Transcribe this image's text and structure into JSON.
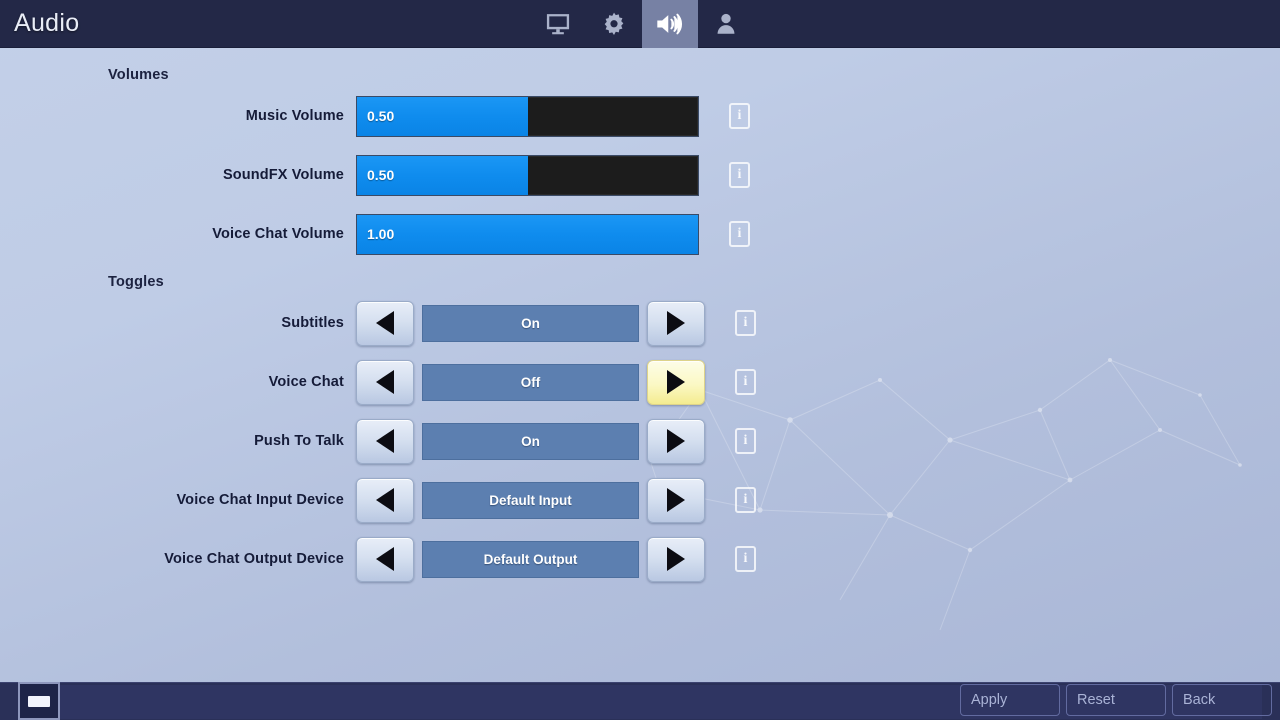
{
  "header": {
    "title": "Audio",
    "tabs": [
      {
        "id": "video",
        "icon": "monitor-icon",
        "active": false
      },
      {
        "id": "game",
        "icon": "gear-icon",
        "active": false
      },
      {
        "id": "audio",
        "icon": "speaker-icon",
        "active": true
      },
      {
        "id": "account",
        "icon": "person-icon",
        "active": false
      }
    ]
  },
  "sections": {
    "volumes_title": "Volumes",
    "toggles_title": "Toggles"
  },
  "volumes": [
    {
      "label": "Music Volume",
      "value": "0.50",
      "fill_percent": 50,
      "info": "i"
    },
    {
      "label": "SoundFX Volume",
      "value": "0.50",
      "fill_percent": 50,
      "info": "i"
    },
    {
      "label": "Voice Chat Volume",
      "value": "1.00",
      "fill_percent": 100,
      "info": "i"
    }
  ],
  "toggles": [
    {
      "label": "Subtitles",
      "value": "On",
      "left_arrow": "◀",
      "right_arrow": "▶",
      "right_highlighted": false,
      "info": "i"
    },
    {
      "label": "Voice Chat",
      "value": "Off",
      "left_arrow": "◀",
      "right_arrow": "▶",
      "right_highlighted": true,
      "info": "i"
    },
    {
      "label": "Push To Talk",
      "value": "On",
      "left_arrow": "◀",
      "right_arrow": "▶",
      "right_highlighted": false,
      "info": "i"
    },
    {
      "label": "Voice Chat Input Device",
      "value": "Default Input",
      "left_arrow": "◀",
      "right_arrow": "▶",
      "right_highlighted": false,
      "info": "i"
    },
    {
      "label": "Voice Chat Output Device",
      "value": "Default Output",
      "left_arrow": "◀",
      "right_arrow": "▶",
      "right_highlighted": false,
      "info": "i"
    }
  ],
  "footer": {
    "key_hint": "",
    "buttons": [
      {
        "label": "Apply"
      },
      {
        "label": "Reset"
      },
      {
        "label": "Back"
      }
    ]
  },
  "colors": {
    "header_bg": "#232847",
    "active_tab_bg": "#7781a4",
    "slider_fill": "#0f8cee",
    "slider_track": "#1c1c1c",
    "toggle_box": "#5c7fb0",
    "highlight_yellow": "#fbf8c4",
    "footer_bg": "#2a3058",
    "label_text": "#151b38"
  }
}
